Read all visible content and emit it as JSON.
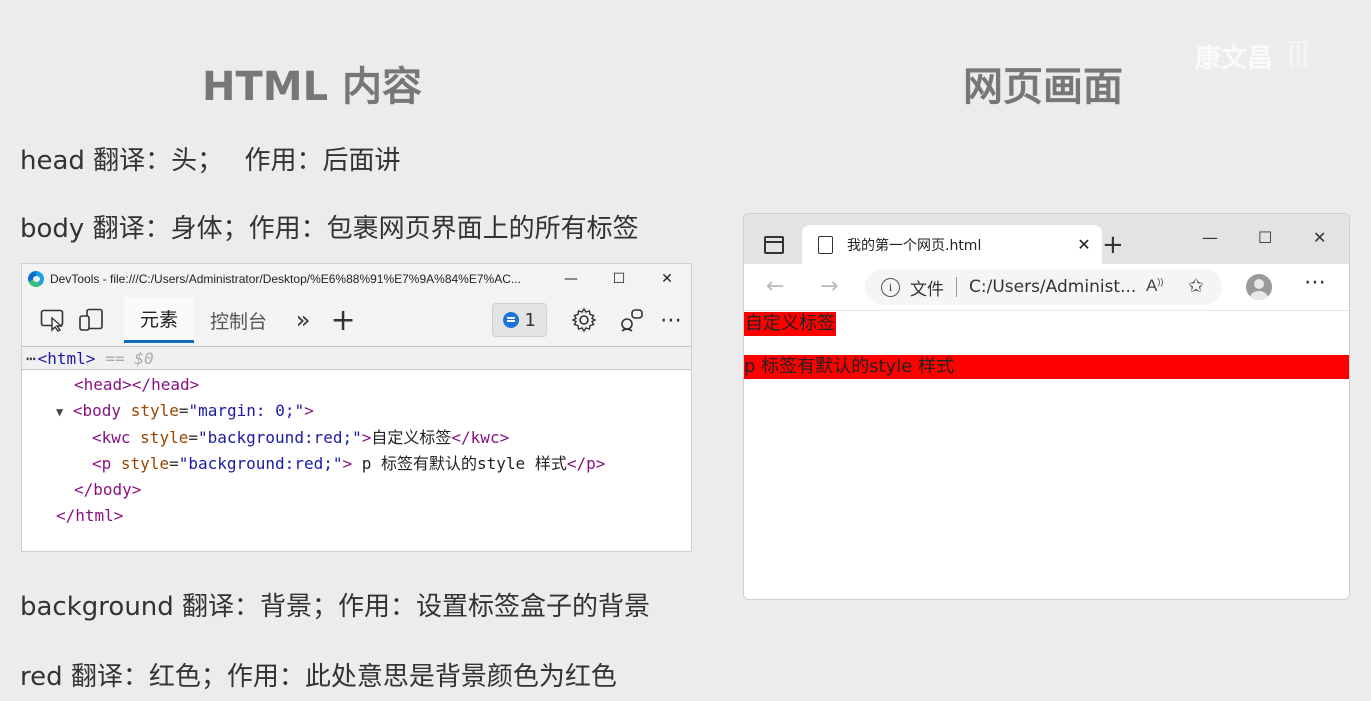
{
  "headings": {
    "left": "HTML 内容",
    "right": "网页画面"
  },
  "watermark": "康文昌",
  "notes": {
    "head": "head 翻译：头；　 作用：后面讲",
    "body": "body 翻译：身体；作用：包裹网页界面上的所有标签",
    "background": "background 翻译：背景；作用：设置标签盒子的背景",
    "red": "red 翻译：红色；作用：此处意思是背景颜色为红色"
  },
  "devtools": {
    "title": "DevTools - file:///C:/Users/Administrator/Desktop/%E6%88%91%E7%9A%84%E7%AC...",
    "tabs": [
      "元素",
      "控制台"
    ],
    "issues_count": "1",
    "selected_line": "<html>",
    "selected_hint": "== $0",
    "code": {
      "head": "<head></head>",
      "body_open_tag": "<body",
      "body_attr": "style",
      "body_val": "\"margin: 0;\"",
      "kwc_open_tag": "<kwc",
      "kwc_attr": "style",
      "kwc_val": "\"background:red;\"",
      "kwc_text": "自定义标签",
      "kwc_close": "</kwc>",
      "p_open_tag": "<p",
      "p_attr": "style",
      "p_val": "\"background:red;\"",
      "p_text": " p 标签有默认的style 样式",
      "p_close": "</p>",
      "body_close": "</body>",
      "html_close": "</html>"
    }
  },
  "browser": {
    "tab_title": "我的第一个网页.html",
    "address_label": "文件",
    "address_url": "C:/Users/Administ...",
    "content": {
      "kwc_text": "自定义标签",
      "p_text": "p 标签有默认的style 样式"
    }
  },
  "colors": {
    "element_background": "#ff0000",
    "accent": "#0f6cbd"
  }
}
